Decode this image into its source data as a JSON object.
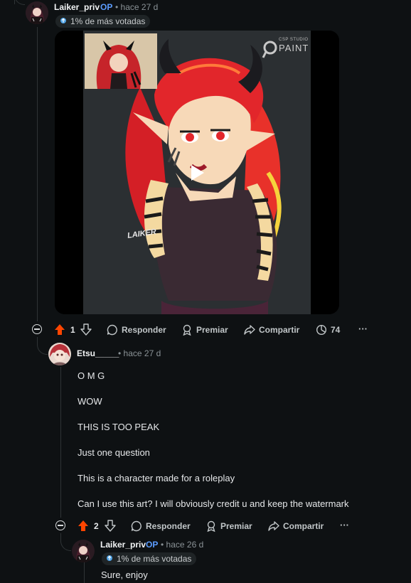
{
  "comments": [
    {
      "username": "Laiker_priv",
      "op_label": "OP",
      "time": "• hace 27 d",
      "badge": "1% de más votadas",
      "media": {
        "watermark_small": "CSP STUDIO",
        "watermark_big": "PAINT",
        "signature": "LAIKER"
      },
      "votes": "1",
      "actions": {
        "reply": "Responder",
        "award": "Premiar",
        "share": "Compartir",
        "views": "74",
        "more": "···"
      }
    },
    {
      "username": "Etsu_____",
      "time": "• hace 27 d",
      "lines": [
        "O M G",
        "WOW",
        "THIS IS TOO PEAK",
        "Just one question",
        "This is a character made for a roleplay",
        "Can I use this art? I will obviously credit u and keep the watermark"
      ],
      "votes": "2",
      "actions": {
        "reply": "Responder",
        "award": "Premiar",
        "share": "Compartir",
        "more": "···"
      }
    },
    {
      "username": "Laiker_priv",
      "op_label": "OP",
      "time": "• hace 26 d",
      "badge": "1% de más votadas",
      "text": "Sure, enjoy"
    }
  ],
  "colors": {
    "background": "#0e1113",
    "upvote_active": "#ff4500",
    "op": "#5c9dff"
  }
}
